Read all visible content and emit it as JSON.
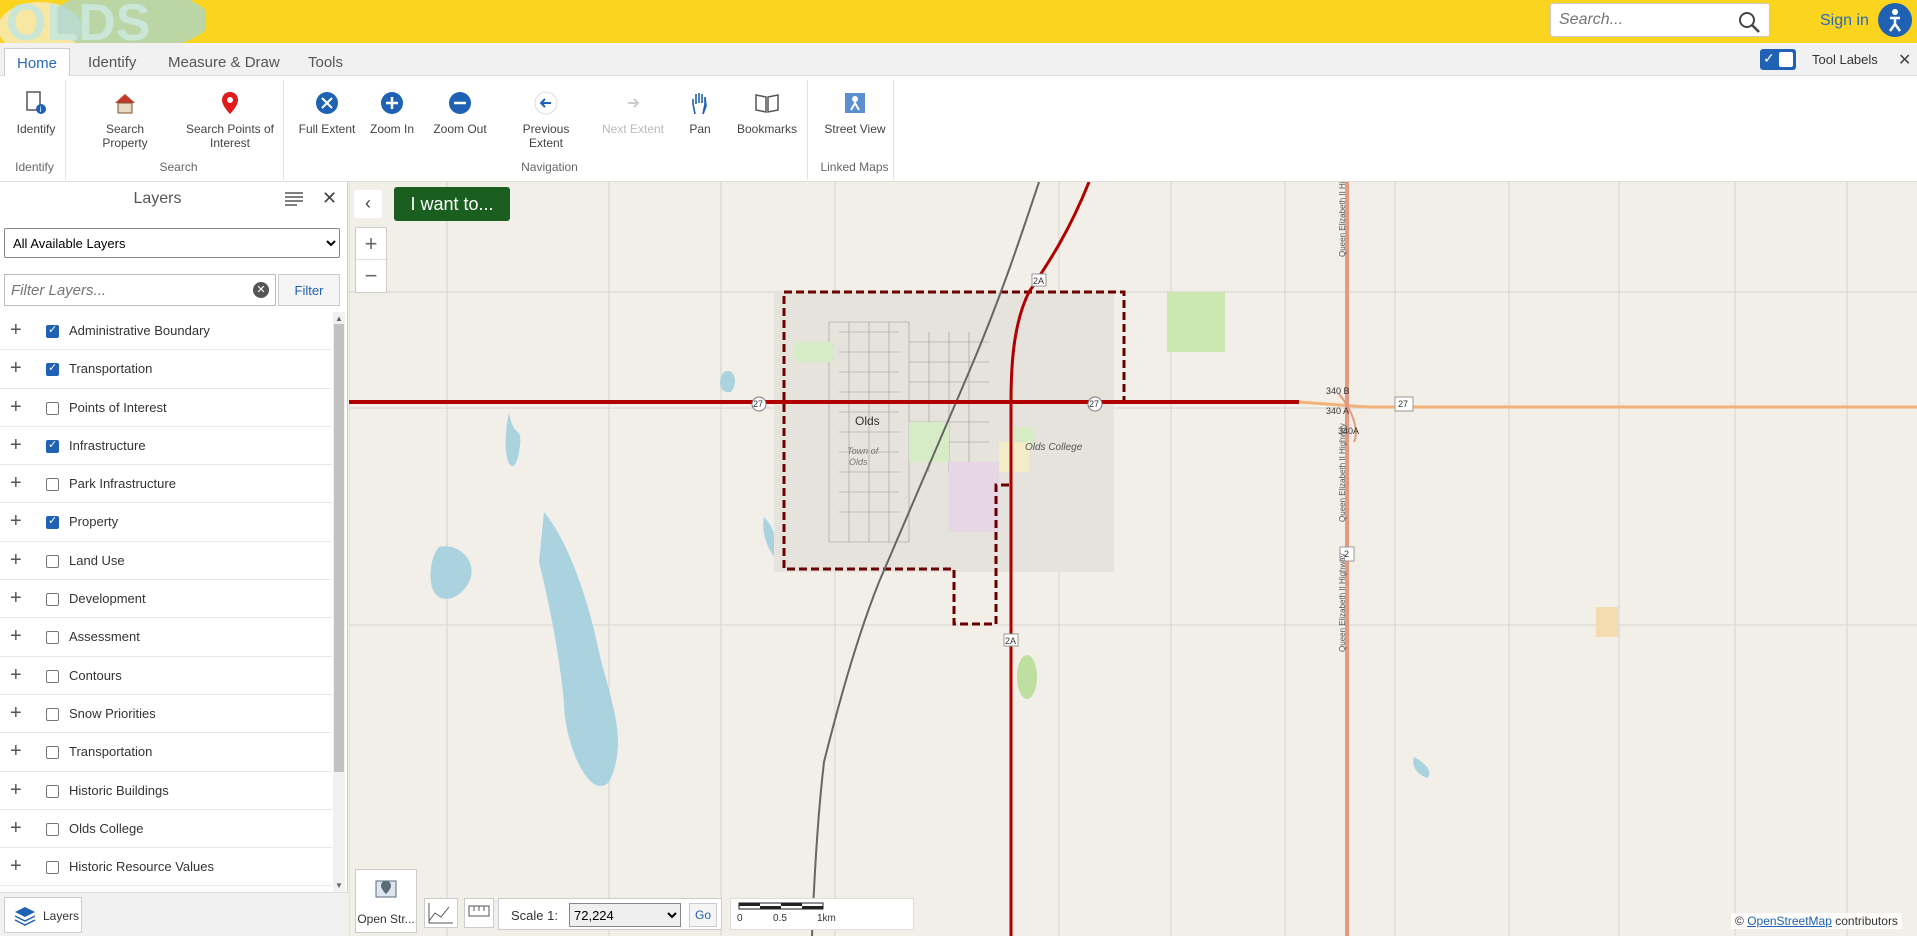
{
  "logo_text": "OLDS",
  "search": {
    "placeholder": "Search..."
  },
  "signin_label": "Sign in",
  "tabs": [
    {
      "label": "Home",
      "active": true
    },
    {
      "label": "Identify"
    },
    {
      "label": "Measure & Draw"
    },
    {
      "label": "Tools"
    }
  ],
  "tool_labels": {
    "label": "Tool Labels",
    "checked": true
  },
  "ribbon": {
    "groups": [
      {
        "label": "Identify",
        "tools": [
          {
            "label": "Identify",
            "icon": "identify-icon"
          }
        ]
      },
      {
        "label": "Search",
        "tools": [
          {
            "label": "Search Property",
            "icon": "house-icon"
          },
          {
            "label": "Search Points of Interest",
            "icon": "map-pin-icon"
          }
        ]
      },
      {
        "label": "Navigation",
        "tools": [
          {
            "label": "Full Extent",
            "icon": "full-extent-icon"
          },
          {
            "label": "Zoom In",
            "icon": "zoom-in-icon"
          },
          {
            "label": "Zoom Out",
            "icon": "zoom-out-icon"
          },
          {
            "label": "Previous Extent",
            "icon": "previous-extent-icon"
          },
          {
            "label": "Next Extent",
            "icon": "next-extent-icon",
            "disabled": true
          },
          {
            "label": "Pan",
            "icon": "hand-icon"
          },
          {
            "label": "Bookmarks",
            "icon": "book-icon"
          }
        ]
      },
      {
        "label": "Linked Maps",
        "tools": [
          {
            "label": "Street View",
            "icon": "street-view-icon"
          }
        ]
      }
    ]
  },
  "panel": {
    "title": "Layers",
    "layer_select": "All Available Layers",
    "filter_placeholder": "Filter Layers...",
    "filter_button": "Filter",
    "layers": [
      {
        "name": "Administrative Boundary",
        "checked": true
      },
      {
        "name": "Transportation",
        "checked": true
      },
      {
        "name": "Points of Interest",
        "checked": false
      },
      {
        "name": "Infrastructure",
        "checked": true
      },
      {
        "name": "Park Infrastructure",
        "checked": false
      },
      {
        "name": "Property",
        "checked": true
      },
      {
        "name": "Land Use",
        "checked": false
      },
      {
        "name": "Development",
        "checked": false
      },
      {
        "name": "Assessment",
        "checked": false
      },
      {
        "name": "Contours",
        "checked": false
      },
      {
        "name": "Snow Priorities",
        "checked": false
      },
      {
        "name": "Transportation",
        "checked": false
      },
      {
        "name": "Historic Buildings",
        "checked": false
      },
      {
        "name": "Olds College",
        "checked": false
      },
      {
        "name": "Historic Resource Values",
        "checked": false
      }
    ],
    "footer_tab": "Layers"
  },
  "map": {
    "i_want_to": "I want to...",
    "labels": {
      "town": "Olds",
      "college": "Olds College",
      "town_of_olds_1": "Town of",
      "town_of_olds_2": "Olds",
      "highway_name": "Queen Elizabeth II Highway",
      "highway_name_2": "Queen Elizabeth II Highway",
      "highway_name_3": "Queen Elizabeth II Highway",
      "exit_340b": "340 B",
      "exit_340a": "340 A",
      "exit_340a_2": "340A",
      "shield_27_west": "27",
      "shield_27_east": "27",
      "shield_27_mid": "27",
      "shield_2a_north": "2A",
      "shield_2a_south": "2A",
      "shield_2": "2"
    },
    "opentool_label": "Open Str...",
    "scale_label": "Scale 1:",
    "scale_value": "72,224",
    "scale_go": "Go",
    "scaleline": {
      "t0": "0",
      "t1": "0.5",
      "t2": "1km"
    },
    "attribution_prefix": "© ",
    "attribution_link": "OpenStreetMap",
    "attribution_suffix": " contributors"
  },
  "colors": {
    "topbar": "#fad41e",
    "accent": "#1f62b4",
    "iwant": "#1a5e20",
    "boundary": "#6b0000",
    "highway": "#b00000",
    "water": "#aad3df",
    "park": "#c8e6a8"
  }
}
